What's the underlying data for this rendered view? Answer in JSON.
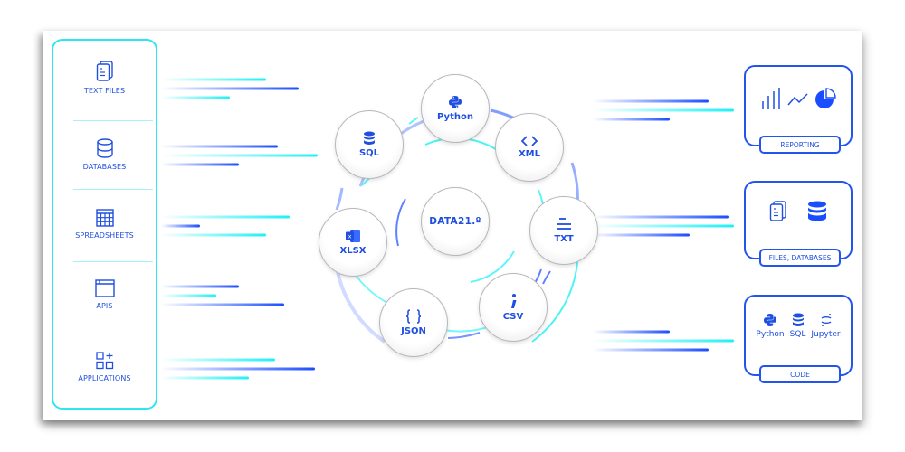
{
  "sources": {
    "items": [
      {
        "label": "TEXT FILES",
        "icon": "text-files-icon"
      },
      {
        "label": "DATABASES",
        "icon": "database-icon"
      },
      {
        "label": "SPREADSHEETS",
        "icon": "spreadsheet-icon"
      },
      {
        "label": "APIS",
        "icon": "api-window-icon"
      },
      {
        "label": "APPLICATIONS",
        "icon": "applications-grid-icon"
      }
    ]
  },
  "hub": {
    "center_label": "DATA21.º",
    "nodes": [
      {
        "label": "Python",
        "icon": "python-icon"
      },
      {
        "label": "XML",
        "icon": "code-brackets-icon"
      },
      {
        "label": "TXT",
        "icon": "text-lines-icon"
      },
      {
        "label": "CSV",
        "icon": "semicolon-icon"
      },
      {
        "label": "JSON",
        "icon": "curly-braces-icon"
      },
      {
        "label": "XLSX",
        "icon": "excel-icon"
      },
      {
        "label": "SQL",
        "icon": "database-icon"
      }
    ]
  },
  "outputs": [
    {
      "label": "REPORTING",
      "icons": [
        "bar-chart-icon",
        "line-chart-icon",
        "pie-chart-icon"
      ]
    },
    {
      "label": "FILES, DATABASES",
      "icons": [
        "files-icon",
        "database-icon"
      ]
    },
    {
      "label": "CODE",
      "items": [
        {
          "label": "Python",
          "icon": "python-icon"
        },
        {
          "label": "SQL",
          "icon": "database-icon"
        },
        {
          "label": "Jupyter",
          "icon": "jupyter-icon"
        }
      ]
    }
  ],
  "colors": {
    "cyan": "#1ef0f5",
    "blue": "#1a4dff",
    "label_blue": "#1f4fe0"
  }
}
